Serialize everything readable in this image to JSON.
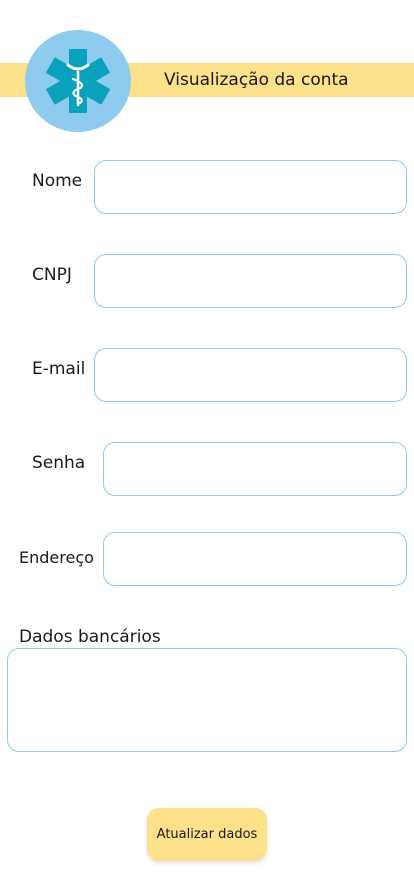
{
  "header": {
    "title": "Visualização da conta",
    "logo_icon": "medical-star-of-life-icon",
    "band_color": "#fde08a",
    "logo_color": "#8ecbee",
    "logo_symbol_color": "#0aa1bd"
  },
  "form": {
    "fields": [
      {
        "label": "Nome",
        "value": ""
      },
      {
        "label": "CNPJ",
        "value": ""
      },
      {
        "label": "E-mail",
        "value": ""
      },
      {
        "label": "Senha",
        "value": ""
      },
      {
        "label": "Endereço",
        "value": ""
      }
    ],
    "bank": {
      "label": "Dados bancários",
      "value": ""
    },
    "submit_label": "Atualizar dados",
    "border_color": "#8ecbee",
    "button_color": "#fde08a"
  }
}
